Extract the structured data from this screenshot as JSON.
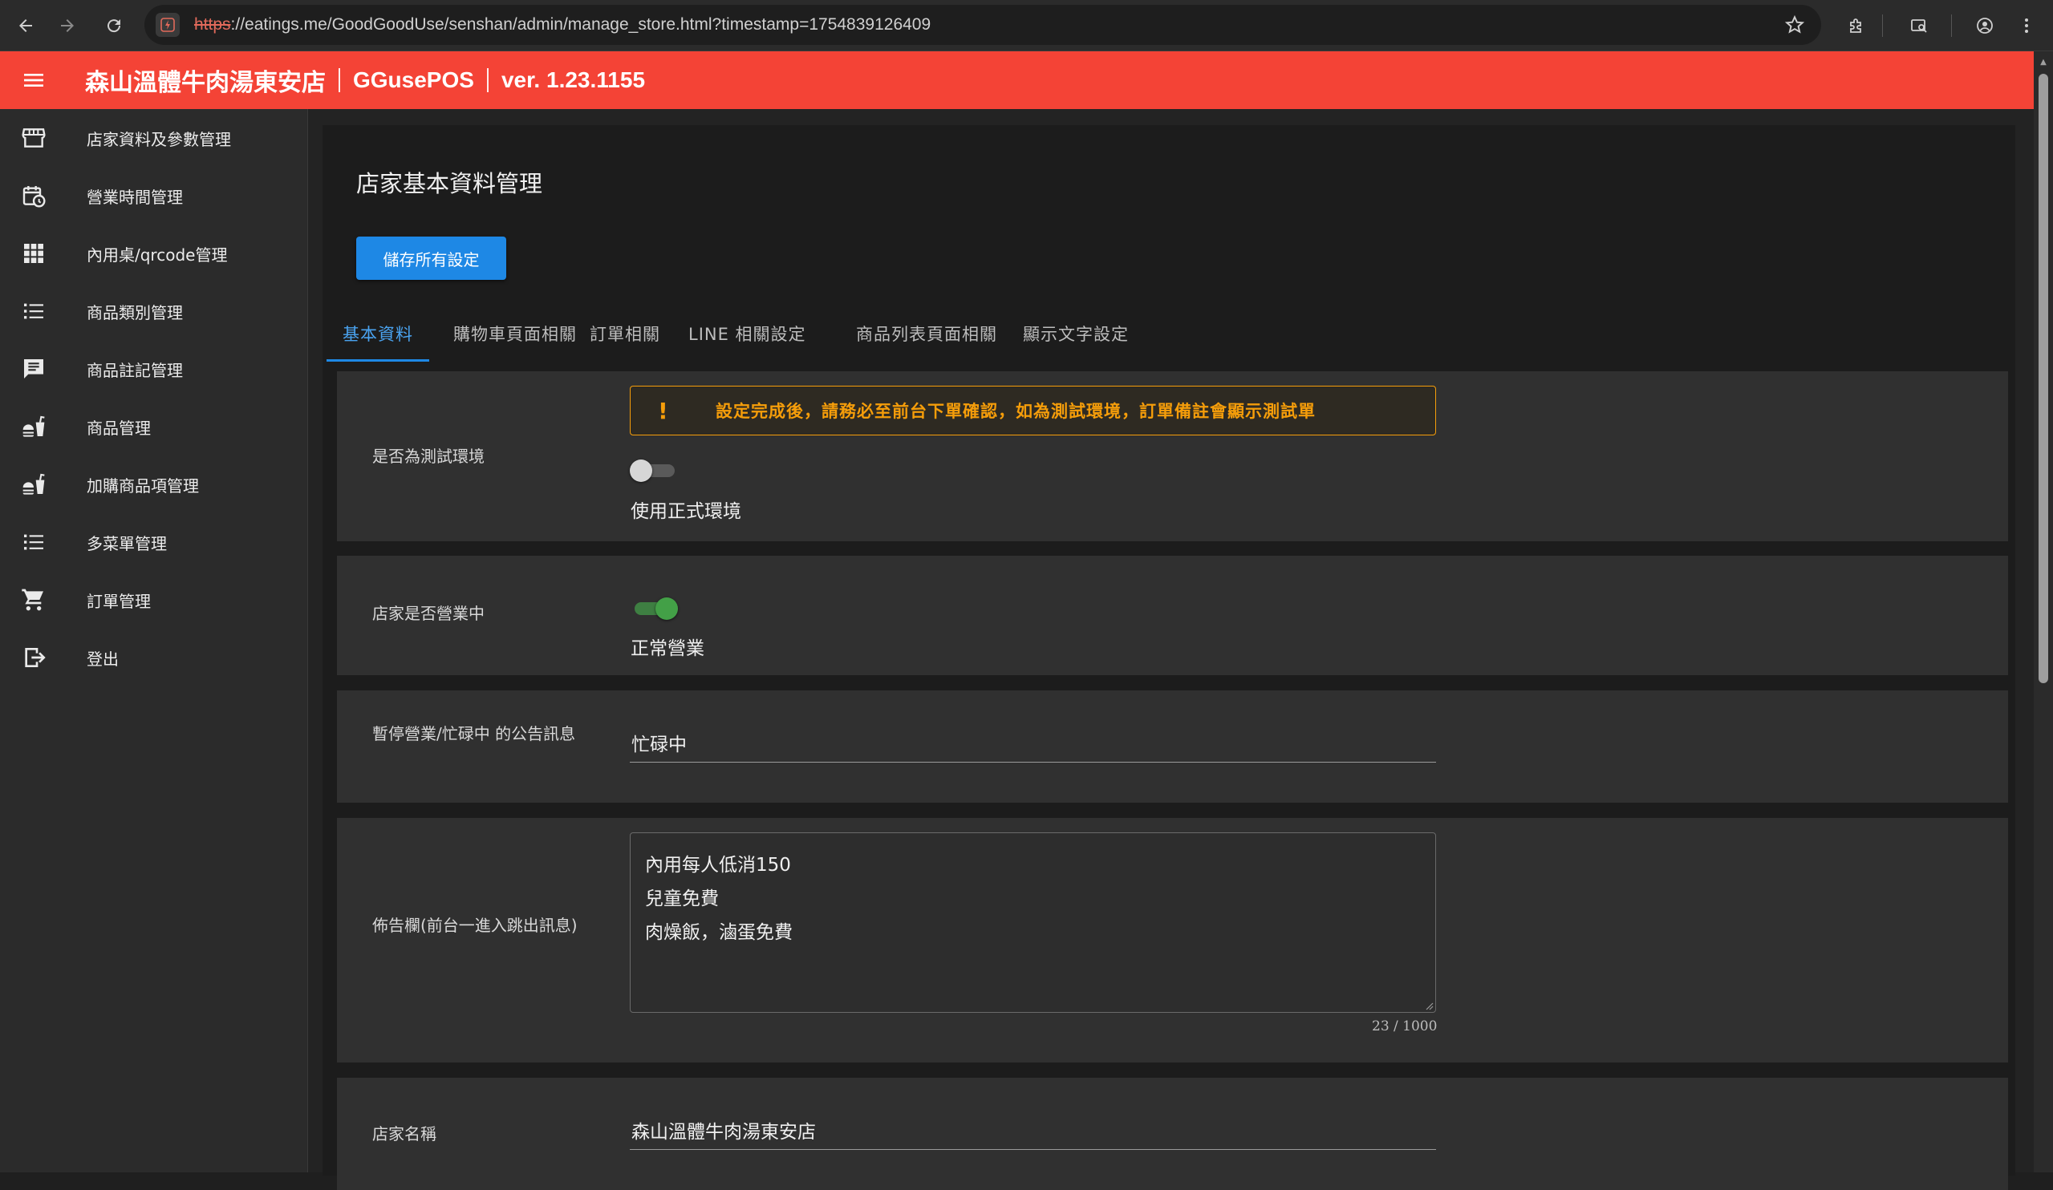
{
  "browser": {
    "url_scheme": "https",
    "url_rest": "://eatings.me/GoodGoodUse/senshan/admin/manage_store.html?timestamp=1754839126409"
  },
  "header": {
    "store_name": "森山溫體牛肉湯東安店",
    "brand": "GGusePOS",
    "version": "ver. 1.23.1155",
    "color": "#f44336"
  },
  "sidebar": {
    "items": [
      {
        "label": "店家資料及參數管理",
        "icon": "store-icon"
      },
      {
        "label": "營業時間管理",
        "icon": "calendar-clock-icon"
      },
      {
        "label": "內用桌/qrcode管理",
        "icon": "grid-icon"
      },
      {
        "label": "商品類別管理",
        "icon": "list-icon"
      },
      {
        "label": "商品註記管理",
        "icon": "comment-icon"
      },
      {
        "label": "商品管理",
        "icon": "food-icon"
      },
      {
        "label": "加購商品項管理",
        "icon": "food-icon"
      },
      {
        "label": "多菜單管理",
        "icon": "list-icon"
      },
      {
        "label": "訂單管理",
        "icon": "cart-icon"
      },
      {
        "label": "登出",
        "icon": "logout-icon"
      }
    ]
  },
  "main": {
    "title": "店家基本資料管理",
    "save_button": "儲存所有設定",
    "tabs": [
      "基本資料",
      "購物車頁面相關",
      "訂單相關",
      "LINE 相關設定",
      "商品列表頁面相關",
      "顯示文字設定"
    ],
    "active_tab": 0
  },
  "rows": {
    "test_env": {
      "label": "是否為測試環境",
      "alert_icon": "!",
      "alert_text": "設定完成後，請務必至前台下單確認，如為測試環境，訂單備註會顯示測試單",
      "switch_on": false,
      "caption": "使用正式環境"
    },
    "is_open": {
      "label": "店家是否營業中",
      "switch_on": true,
      "caption": "正常營業"
    },
    "pause_message": {
      "label": "暫停營業/忙碌中 的公告訊息",
      "value": "忙碌中"
    },
    "bulletin": {
      "label": "佈告欄(前台一進入跳出訊息)",
      "lines": [
        "內用每人低消150",
        "兒童免費",
        "肉燥飯，滷蛋免費"
      ],
      "counter": "23 / 1000"
    },
    "store_name": {
      "label": "店家名稱",
      "value": "森山溫體牛肉湯東安店"
    }
  },
  "colors": {
    "accent": "#1e88e5",
    "warning": "#f59d0a",
    "switch_on": "#43a047"
  }
}
